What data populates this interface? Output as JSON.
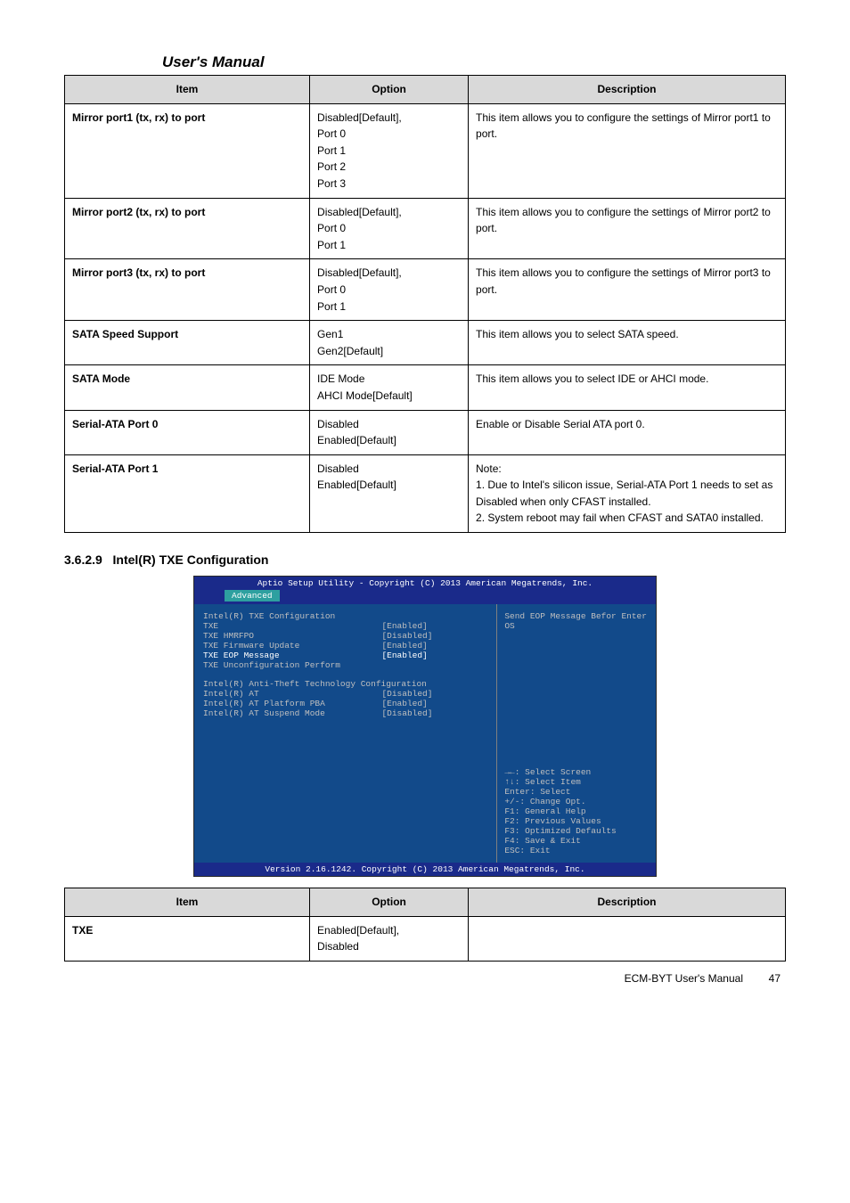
{
  "header": {
    "manual_title": "User's Manual"
  },
  "table1": {
    "cols": [
      "Item",
      "Option",
      "Description"
    ],
    "rows": [
      {
        "item": "Mirror port1 (tx, rx) to port",
        "option": "Disabled[Default],\nPort 0\nPort 1\nPort 2\nPort 3",
        "desc": "This item allows you to configure the settings of Mirror port1 to port."
      },
      {
        "item": "Mirror port2 (tx, rx) to port",
        "option": "Disabled[Default],\nPort 0\nPort 1",
        "desc": "This item allows you to configure the settings of Mirror port2 to port."
      },
      {
        "item": "Mirror port3 (tx, rx) to port",
        "option": "Disabled[Default],\nPort 0\nPort 1",
        "desc": "This item allows you to configure the settings of Mirror port3 to port."
      },
      {
        "item": "SATA Speed Support",
        "option": "Gen1\nGen2[Default]",
        "desc": "This item allows you to select SATA speed."
      },
      {
        "item": "SATA Mode",
        "option": "IDE Mode\nAHCI Mode[Default]",
        "desc": "This item allows you to select IDE or AHCI mode."
      },
      {
        "item": "Serial-ATA Port 0",
        "option": "Disabled\nEnabled[Default]",
        "desc": "Enable or Disable Serial ATA port 0."
      },
      {
        "item": "Serial-ATA Port 1",
        "option": "Disabled\nEnabled[Default]",
        "desc": "Note:\n1. Due to Intel's silicon issue, Serial-ATA Port 1 needs to set as Disabled when only CFAST installed.\n2. System reboot may fail when CFAST and SATA0 installed."
      }
    ]
  },
  "section": {
    "number": "3.6.2.9",
    "title": "Intel(R) TXE Configuration"
  },
  "bios": {
    "top": "Aptio Setup Utility - Copyright (C) 2013 American Megatrends, Inc.",
    "tab": "Advanced",
    "left_title": "Intel(R) TXE Configuration",
    "rows": [
      {
        "lbl": "TXE",
        "val": "[Enabled]"
      },
      {
        "lbl": "TXE HMRFPO",
        "val": "[Disabled]"
      },
      {
        "lbl": "TXE Firmware Update",
        "val": "[Enabled]"
      },
      {
        "lbl": "TXE EOP Message",
        "val": "[Enabled]",
        "hi": true
      },
      {
        "lbl": "TXE Unconfiguration Perform",
        "val": ""
      }
    ],
    "at_title": "Intel(R) Anti-Theft Technology Configuration",
    "at_rows": [
      {
        "lbl": "Intel(R) AT",
        "val": "[Disabled]"
      },
      {
        "lbl": "Intel(R) AT Platform PBA",
        "val": "[Enabled]"
      },
      {
        "lbl": "Intel(R) AT Suspend Mode",
        "val": "[Disabled]"
      }
    ],
    "help": "Send EOP Message Befor Enter OS",
    "keys": [
      "→←: Select Screen",
      "↑↓: Select Item",
      "Enter: Select",
      "+/-: Change Opt.",
      "F1: General Help",
      "F2: Previous Values",
      "F3: Optimized Defaults",
      "F4: Save & Exit",
      "ESC: Exit"
    ],
    "bottom": "Version 2.16.1242. Copyright (C) 2013 American Megatrends, Inc."
  },
  "table2": {
    "cols": [
      "Item",
      "Option",
      "Description"
    ],
    "rows": [
      {
        "item": "TXE",
        "option": "Enabled[Default],\nDisabled",
        "desc": ""
      }
    ]
  },
  "footer": {
    "doc_title": "ECM-BYT User's Manual",
    "page": "47"
  }
}
